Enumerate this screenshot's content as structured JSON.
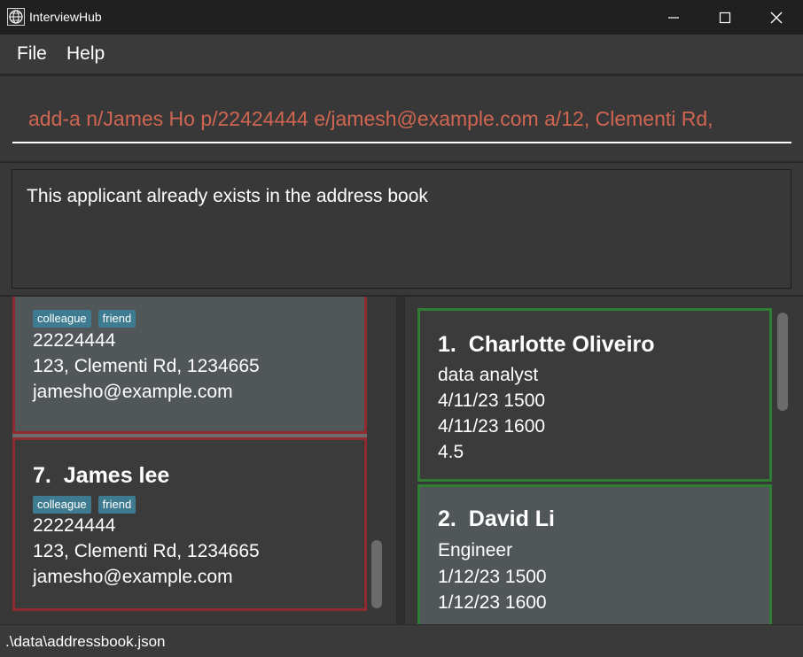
{
  "window": {
    "title": "InterviewHub"
  },
  "menu": {
    "items": [
      "File",
      "Help"
    ]
  },
  "command": {
    "value": "add-a n/James Ho p/22424444 e/jamesh@example.com a/12, Clementi Rd,"
  },
  "result": {
    "text": "This applicant already exists in the address book"
  },
  "applicants": [
    {
      "index": "",
      "name": "",
      "tags": [
        "colleague",
        "friend"
      ],
      "phone": "22224444",
      "address": "123, Clementi Rd, 1234665",
      "email": "jamesho@example.com"
    },
    {
      "index": "7.",
      "name": "James lee",
      "tags": [
        "colleague",
        "friend"
      ],
      "phone": "22224444",
      "address": "123, Clementi Rd, 1234665",
      "email": "jamesho@example.com"
    }
  ],
  "interviews": [
    {
      "index": "1.",
      "name": "Charlotte Oliveiro",
      "role": "data analyst",
      "start": "4/11/23 1500",
      "end": "4/11/23 1600",
      "rating": "4.5"
    },
    {
      "index": "2.",
      "name": "David Li",
      "role": "Engineer",
      "start": "1/12/23 1500",
      "end": "1/12/23 1600"
    }
  ],
  "status": {
    "path": ".\\data\\addressbook.json"
  },
  "colors": {
    "command_text": "#d06651",
    "applicant_border": "#8d2b2e",
    "interview_border": "#2f7d32",
    "tag_bg": "#3e7b91"
  },
  "icons": [
    "globe-icon",
    "minimize-icon",
    "maximize-icon",
    "close-icon"
  ]
}
